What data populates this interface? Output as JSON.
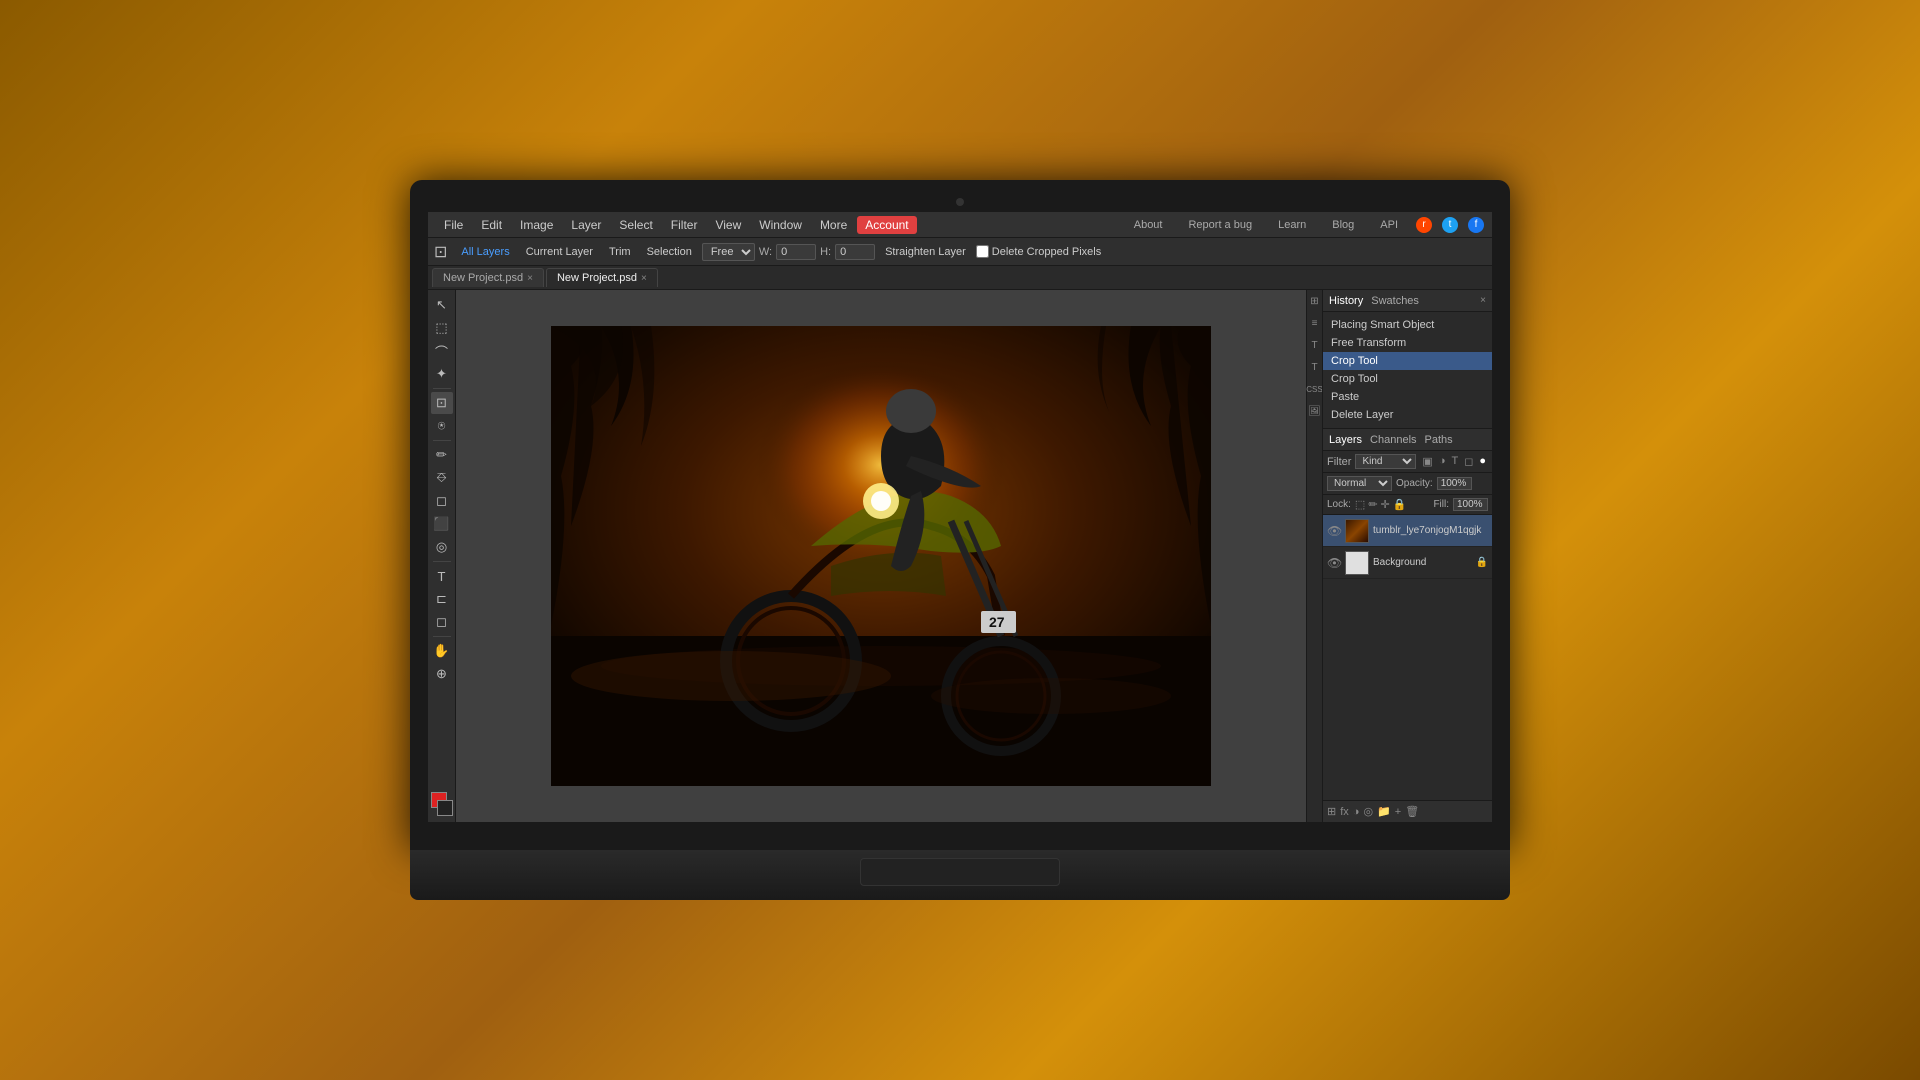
{
  "menubar": {
    "items": [
      {
        "label": "File",
        "id": "file"
      },
      {
        "label": "Edit",
        "id": "edit"
      },
      {
        "label": "Image",
        "id": "image"
      },
      {
        "label": "Layer",
        "id": "layer"
      },
      {
        "label": "Select",
        "id": "select"
      },
      {
        "label": "Filter",
        "id": "filter"
      },
      {
        "label": "View",
        "id": "view"
      },
      {
        "label": "Window",
        "id": "window"
      },
      {
        "label": "More",
        "id": "more"
      },
      {
        "label": "Account",
        "id": "account",
        "active": true
      }
    ],
    "right_items": [
      {
        "label": "About"
      },
      {
        "label": "Report a bug"
      },
      {
        "label": "Learn"
      },
      {
        "label": "Blog"
      },
      {
        "label": "API"
      }
    ]
  },
  "toolbar": {
    "all_layers": "All Layers",
    "current_layer": "Current Layer",
    "trim": "Trim",
    "selection": "Selection",
    "mode_select": "Free",
    "w_label": "W:",
    "w_value": "0",
    "h_value": "0",
    "straighten": "Straighten Layer",
    "delete_cropped": "Delete Cropped Pixels"
  },
  "tabs": [
    {
      "label": "New Project.psd",
      "active": false,
      "id": "tab1"
    },
    {
      "label": "New Project.psd",
      "active": true,
      "id": "tab2"
    }
  ],
  "history_panel": {
    "tabs": [
      "History",
      "Swatches"
    ],
    "active_tab": "History",
    "items": [
      {
        "label": "Placing Smart Object"
      },
      {
        "label": "Free Transform"
      },
      {
        "label": "Crop Tool",
        "active": true
      },
      {
        "label": "Crop Tool"
      },
      {
        "label": "Paste"
      },
      {
        "label": "Delete Layer"
      }
    ]
  },
  "layers_panel": {
    "tabs": [
      "Layers",
      "Channels",
      "Paths"
    ],
    "active_tab": "Layers",
    "filter_label": "Filter",
    "filter_kind": "Kind",
    "blend_mode": "Normal",
    "opacity_label": "Opacity:",
    "opacity_value": "100%",
    "fill_label": "Fill:",
    "fill_value": "100%",
    "lock_label": "Lock:",
    "layers": [
      {
        "name": "tumblr_lye7onjogM1qgjk",
        "type": "image",
        "visible": true,
        "locked": false,
        "active": true
      },
      {
        "name": "Background",
        "type": "plain",
        "visible": true,
        "locked": true,
        "active": false
      }
    ]
  },
  "tools": [
    {
      "icon": "↖",
      "name": "move-tool"
    },
    {
      "icon": "⬚",
      "name": "rectangular-marquee-tool"
    },
    {
      "icon": "⊙",
      "name": "lasso-tool"
    },
    {
      "icon": "✦",
      "name": "magic-wand-tool"
    },
    {
      "icon": "✂",
      "name": "crop-tool",
      "active": true
    },
    {
      "icon": "✏",
      "name": "brush-tool"
    },
    {
      "icon": "⎇",
      "name": "clone-stamp-tool"
    },
    {
      "icon": "✱",
      "name": "eraser-tool"
    },
    {
      "icon": "⬛",
      "name": "gradient-tool"
    },
    {
      "icon": "◎",
      "name": "blur-tool"
    },
    {
      "icon": "☉",
      "name": "dodge-tool"
    },
    {
      "icon": "T",
      "name": "type-tool"
    },
    {
      "icon": "⊏",
      "name": "pen-tool"
    },
    {
      "icon": "◻",
      "name": "shape-tool"
    },
    {
      "icon": "◈",
      "name": "eyedropper-tool"
    },
    {
      "icon": "⊕",
      "name": "zoom-tool"
    }
  ],
  "canvas": {
    "image_alt": "Motocross rider on dirt bike performing wheelie at sunset with trees in background"
  }
}
